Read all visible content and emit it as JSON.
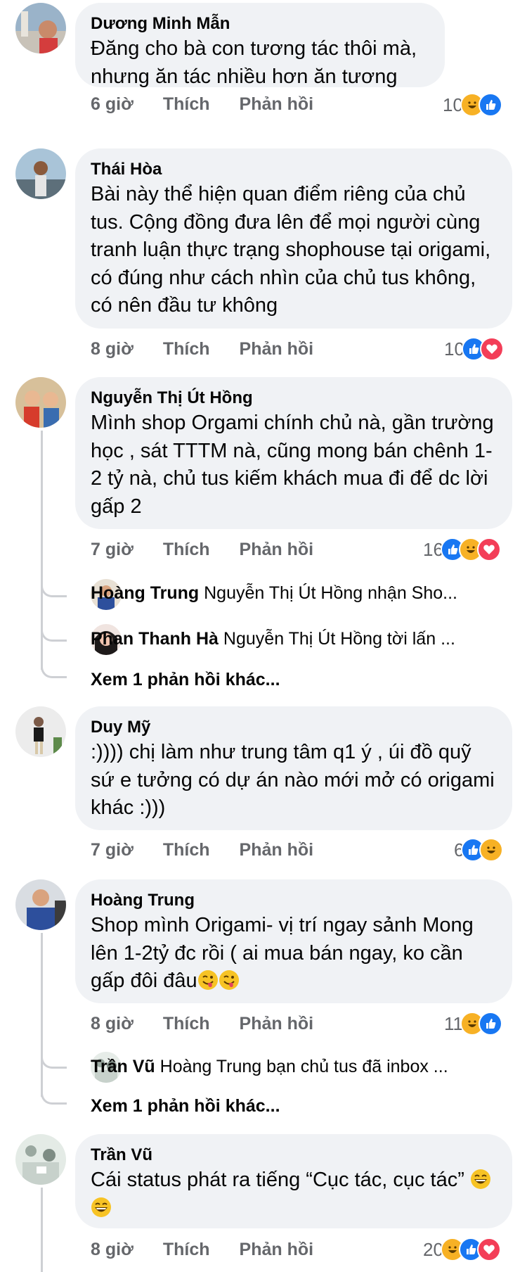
{
  "comments": [
    {
      "author": "Dương Minh Mẫn",
      "text": "Đăng cho bà con tương tác thôi mà, nhưng ăn tác nhiều hơn ăn tương",
      "time": "6 giờ",
      "like": "Thích",
      "reply": "Phản hồi",
      "count": "10",
      "reactions": [
        "haha",
        "like"
      ]
    },
    {
      "author": "Thái Hòa",
      "text": "Bài này thể hiện quan điểm riêng của chủ tus. Cộng đồng đưa lên để mọi người cùng tranh luận thực trạng shophouse tại origami, có đúng như cách nhìn của chủ tus không, có nên đầu tư không",
      "time": "8 giờ",
      "like": "Thích",
      "reply": "Phản hồi",
      "count": "10",
      "reactions": [
        "like",
        "love"
      ]
    },
    {
      "author": "Nguyễn Thị Út Hồng",
      "text": "Mình shop Orgami chính chủ nà, gần trường học , sát TTTM nà, cũng mong bán chênh 1-2 tỷ nà, chủ tus kiếm khách mua đi để dc lời gấp 2",
      "time": "7 giờ",
      "like": "Thích",
      "reply": "Phản hồi",
      "count": "16",
      "reactions": [
        "like",
        "haha",
        "love"
      ],
      "replies": [
        {
          "author": "Hoàng Trung",
          "text": "Nguyễn Thị Út Hồng nhận Sho..."
        },
        {
          "author": "Phan Thanh Hà",
          "text": "Nguyễn Thị Út Hồng tời lấn ..."
        }
      ],
      "more": "Xem 1 phản hồi khác..."
    },
    {
      "author": "Duy Mỹ",
      "text": ":)))) chị làm như trung tâm q1 ý , úi đồ quỹ sứ e tưởng có dự án nào mới mở có origami khác :)))",
      "time": "7 giờ",
      "like": "Thích",
      "reply": "Phản hồi",
      "count": "6",
      "reactions": [
        "like",
        "haha"
      ]
    },
    {
      "author": "Hoàng Trung",
      "text": "Shop mình Origami- vị trí ngay sảnh Mong lên 1-2tỷ đc rồi ( ai mua bán ngay, ko cần gấp đôi đâu",
      "time": "8 giờ",
      "like": "Thích",
      "reply": "Phản hồi",
      "count": "11",
      "reactions": [
        "haha",
        "like"
      ],
      "replies": [
        {
          "author": "Trần Vũ",
          "text": "Hoàng Trung bạn chủ tus đã inbox ..."
        }
      ],
      "more": "Xem 1 phản hồi khác..."
    },
    {
      "author": "Trần Vũ",
      "text": "Cái status phát ra tiếng “Cục tác, cục tác”",
      "time": "8 giờ",
      "like": "Thích",
      "reply": "Phản hồi",
      "count": "20",
      "reactions": [
        "haha",
        "like",
        "love"
      ]
    }
  ],
  "colors": {
    "bubble": "#f0f2f5",
    "meta": "#65676b",
    "like": "#1877f2",
    "love": "#f33e58",
    "haha": "#f7b125"
  }
}
